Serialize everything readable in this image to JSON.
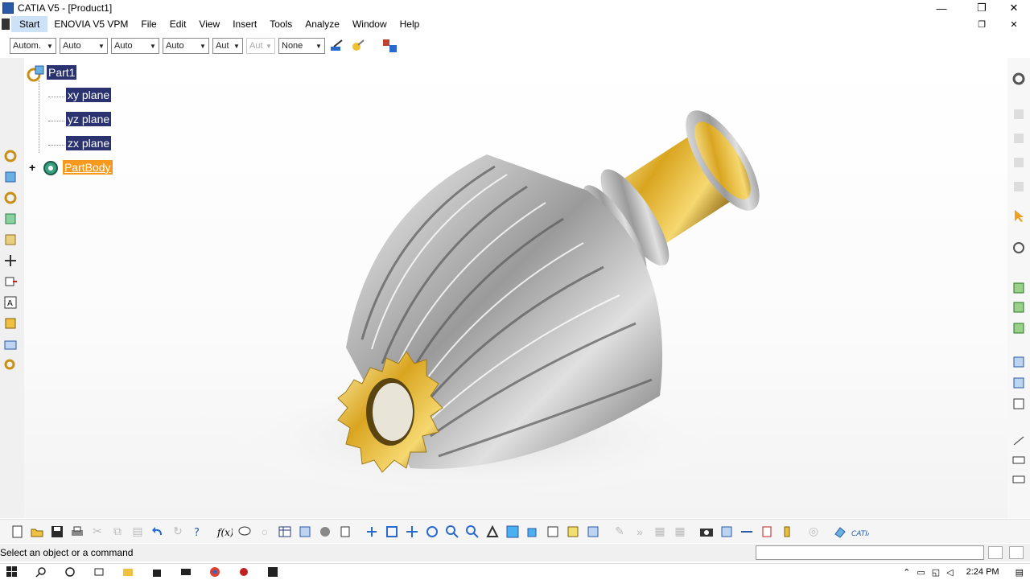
{
  "window": {
    "title": "CATIA V5 - [Product1]",
    "minimize_icon": "minimize-icon",
    "maximize_icon": "restore-icon",
    "close_icon": "close-icon",
    "min_glyph": "—",
    "max_glyph": "❐",
    "close_glyph": "✕",
    "inner_restore_glyph": "❐",
    "inner_close_glyph": "✕"
  },
  "menu": {
    "items": [
      "Start",
      "ENOVIA V5 VPM",
      "File",
      "Edit",
      "View",
      "Insert",
      "Tools",
      "Analyze",
      "Window",
      "Help"
    ]
  },
  "graphic_properties": {
    "fill_color": "Autom.",
    "line_color": "Auto",
    "line_type": "Auto",
    "line_thickness": "Auto",
    "point_symbol": "Aut",
    "layer_disabled": "Aut",
    "layer": "None"
  },
  "tree": {
    "root": "Part1",
    "planes": [
      "xy plane",
      "yz plane",
      "zx plane"
    ],
    "body": "PartBody",
    "expand_glyph": "+"
  },
  "status": {
    "message": "Select an object or a command"
  },
  "taskbar": {
    "time": "2:24 PM"
  },
  "colors": {
    "tree_selected_bg": "#2b3270",
    "partbody_highlight": "#f59a1e",
    "gear_gold": "#d9a520",
    "gear_silver": "#b8b8b8"
  }
}
